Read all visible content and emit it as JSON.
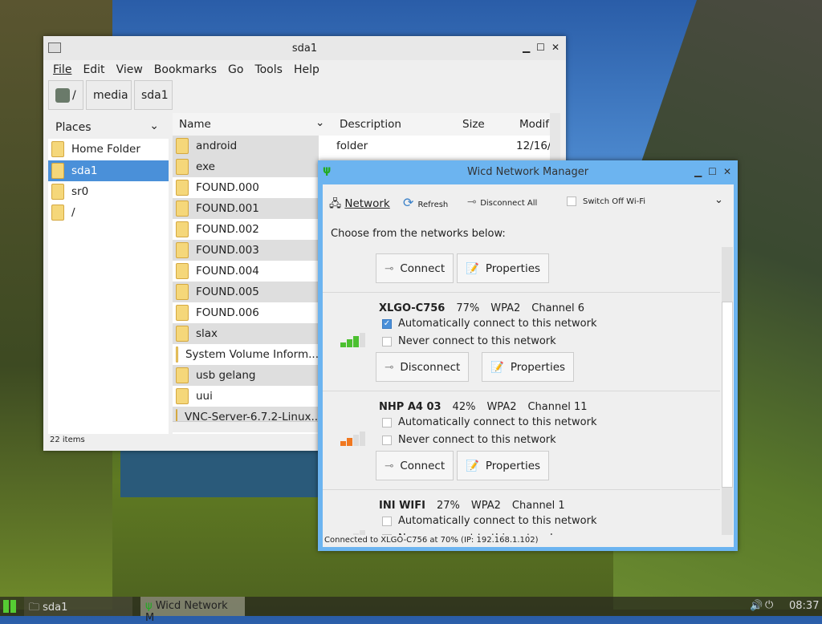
{
  "file_manager": {
    "title": "sda1",
    "menu": [
      "File",
      "Edit",
      "View",
      "Bookmarks",
      "Go",
      "Tools",
      "Help"
    ],
    "path": [
      "/",
      "media",
      "sda1"
    ],
    "places": {
      "header": "Places",
      "items": [
        "Home Folder",
        "sda1",
        "sr0",
        "/"
      ],
      "selected": "sda1"
    },
    "columns": [
      "Name",
      "Description",
      "Size",
      "Modif"
    ],
    "rows": [
      {
        "name": "android",
        "description": "folder",
        "modified": "12/16/"
      },
      {
        "name": "exe"
      },
      {
        "name": "FOUND.000"
      },
      {
        "name": "FOUND.001"
      },
      {
        "name": "FOUND.002"
      },
      {
        "name": "FOUND.003"
      },
      {
        "name": "FOUND.004"
      },
      {
        "name": "FOUND.005"
      },
      {
        "name": "FOUND.006"
      },
      {
        "name": "slax"
      },
      {
        "name": "System Volume Inform..."
      },
      {
        "name": "usb gelang"
      },
      {
        "name": "uui"
      },
      {
        "name": "VNC-Server-6.7.2-Linux..."
      }
    ],
    "status": "22 items"
  },
  "wicd": {
    "title": "Wicd Network Manager",
    "toolbar": {
      "network": "Network",
      "refresh": "Refresh",
      "disconnect_all": "Disconnect All",
      "switch_off": "Switch Off Wi-Fi"
    },
    "prompt": "Choose from the networks below:",
    "connect": "Connect",
    "disconnect": "Disconnect",
    "properties": "Properties",
    "auto": "Automatically connect to this network",
    "never": "Never connect to this network",
    "networks": [
      {
        "name": "XLGO-C756",
        "strength": "77%",
        "security": "WPA2",
        "channel": "Channel 6",
        "auto": true,
        "connected": true,
        "color": "#4cc030"
      },
      {
        "name": "NHP A4 03",
        "strength": "42%",
        "security": "WPA2",
        "channel": "Channel 11",
        "auto": false,
        "connected": false,
        "color": "#f07820"
      },
      {
        "name": "INI WIFI",
        "strength": "27%",
        "security": "WPA2",
        "channel": "Channel 1",
        "auto": false,
        "connected": false
      }
    ],
    "status": "Connected to XLGO-C756 at 70% (IP: 192.168.1.102)"
  },
  "taskbar": {
    "items": [
      "sda1",
      "Wicd Network M"
    ],
    "clock": "08:37"
  }
}
